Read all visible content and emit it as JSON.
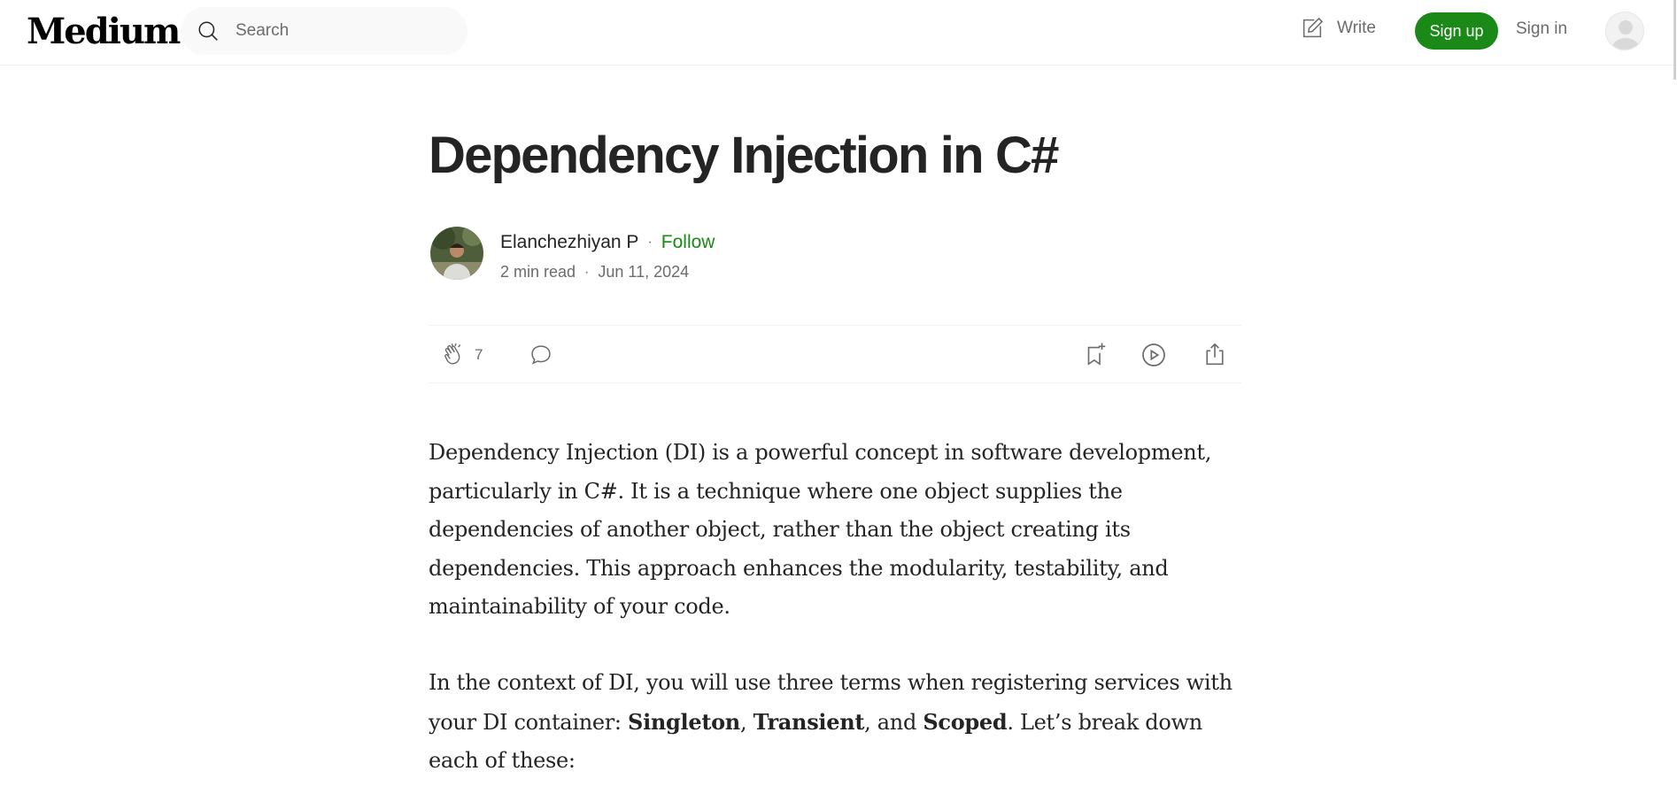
{
  "header": {
    "logo": "Medium",
    "search": {
      "placeholder": "Search"
    },
    "write_label": "Write",
    "signup_label": "Sign up",
    "signin_label": "Sign in"
  },
  "article": {
    "title": "Dependency Injection in C#",
    "author": "Elanchezhiyan P",
    "follow_label": "Follow",
    "read_time": "2 min read",
    "date": "Jun 11, 2024",
    "claps": "7",
    "paragraph1": "Dependency Injection (DI) is a powerful concept in software development, particularly in C#. It is a technique where one object supplies the dependencies of another object, rather than the object creating its dependencies. This approach enhances the modularity, testability, and maintainability of your code.",
    "paragraph2": {
      "intro": "In the context of DI, you will use three terms when registering services with your DI container: ",
      "term1": "Singleton",
      "sep1": ", ",
      "term2": "Transient",
      "sep2": ", and ",
      "term3": "Scoped",
      "outro": ". Let’s break down each of these:"
    }
  },
  "colors": {
    "brand_green": "#1a8917",
    "text": "#242424",
    "muted": "#6b6b6b"
  },
  "icons": [
    "search-icon",
    "write-icon",
    "user-avatar-icon",
    "clap-icon",
    "comment-icon",
    "bookmark-icon",
    "play-icon",
    "share-icon"
  ]
}
